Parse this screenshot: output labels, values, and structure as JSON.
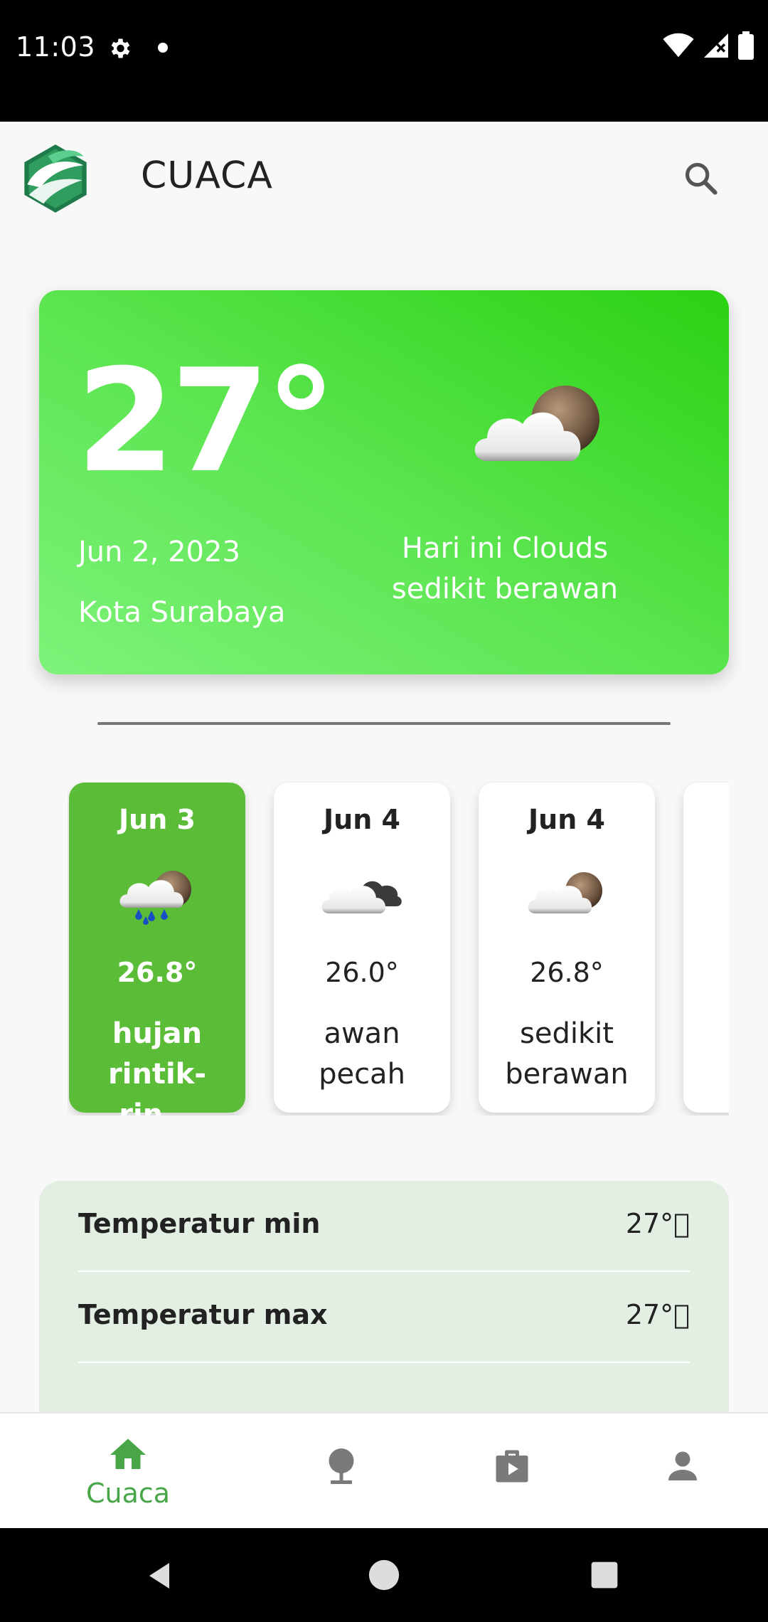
{
  "status_bar": {
    "time": "11:03"
  },
  "app_bar": {
    "title": "CUACA"
  },
  "current": {
    "temperature": "27°",
    "date": "Jun 2, 2023",
    "city": "Kota Surabaya",
    "description": "Hari ini Clouds sedikit berawan",
    "icon": "few-clouds-icon"
  },
  "forecast": [
    {
      "date": "Jun 3",
      "temp": "26.8°",
      "desc": "hujan rintik-rin...",
      "icon": "rain-clouds-icon",
      "selected": true
    },
    {
      "date": "Jun 4",
      "temp": "26.0°",
      "desc": "awan pecah",
      "icon": "broken-clouds-icon",
      "selected": false
    },
    {
      "date": "Jun 4",
      "temp": "26.8°",
      "desc": "sedikit berawan",
      "icon": "few-clouds-icon",
      "selected": false
    }
  ],
  "details": [
    {
      "label": "Temperatur min",
      "value": "27°⃞"
    },
    {
      "label": "Temperatur max",
      "value": "27°⃞"
    }
  ],
  "bottom_nav": {
    "items": [
      {
        "label": "Cuaca",
        "icon": "home-icon",
        "active": true
      },
      {
        "label": "",
        "icon": "globe-pin-icon",
        "active": false
      },
      {
        "label": "",
        "icon": "video-case-icon",
        "active": false
      },
      {
        "label": "",
        "icon": "person-icon",
        "active": false
      }
    ]
  },
  "colors": {
    "accent": "#48a648",
    "hero_gradient_start": "#7ef27a",
    "hero_gradient_end": "#2bd112",
    "selected_card": "#5bbd37",
    "details_bg": "#e4efe3"
  }
}
